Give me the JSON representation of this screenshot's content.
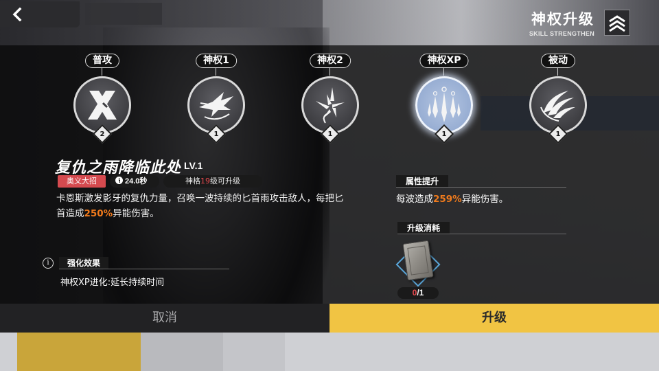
{
  "header": {
    "title": "神权升级",
    "subtitle": "SKILL STRENGTHEN"
  },
  "skills": [
    {
      "label": "普攻",
      "level": "2",
      "active": false
    },
    {
      "label": "神权1",
      "level": "1",
      "active": false
    },
    {
      "label": "神权2",
      "level": "1",
      "active": false
    },
    {
      "label": "神权XP",
      "level": "1",
      "active": true
    },
    {
      "label": "被动",
      "level": "1",
      "active": false
    }
  ],
  "detail": {
    "name": "复仇之雨降临此处",
    "level": "LV.1",
    "tag_type": "奥义大招",
    "cooldown": "24.0秒",
    "requirement_prefix": "神格",
    "requirement_level": "19",
    "requirement_suffix": "级可升级",
    "description_part1": "卡恩斯激发影牙的复仇力量，召唤一波持续的匕首雨攻击敌人，每把匕首造成",
    "description_value": "250%",
    "description_part2": "异能伤害。",
    "enhance_title": "强化效果",
    "enhance_info_icon": "i",
    "enhance_text": "神权XP进化:延长持续时间"
  },
  "attribute": {
    "title": "属性提升",
    "text_part1": "每波造成",
    "value": "259%",
    "text_part2": "异能伤害。"
  },
  "cost": {
    "title": "升级消耗",
    "item_icon": "skill-book-icon",
    "owned": "0",
    "required": "/1"
  },
  "actions": {
    "cancel": "取消",
    "upgrade": "升级"
  },
  "colors": {
    "accent_yellow": "#f1c443",
    "ult_tag": "#d54a4f",
    "highlight_orange": "#f07a1c",
    "owned_red": "#e84a4f",
    "active_skill": "#98aed3"
  }
}
